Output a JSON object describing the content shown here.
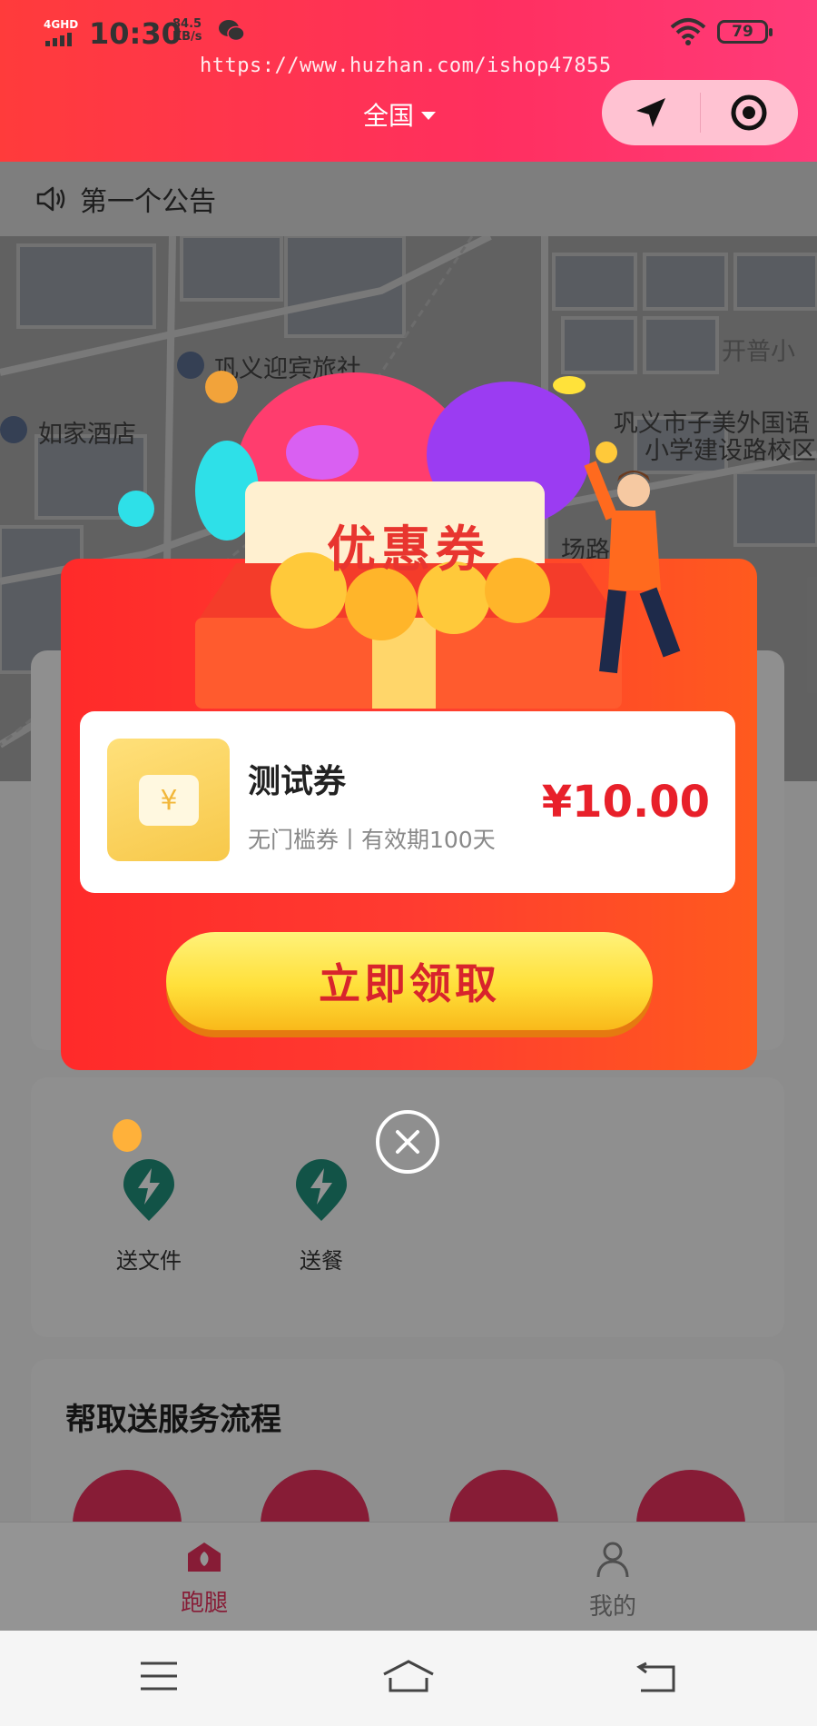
{
  "status_bar": {
    "network": "4GHD",
    "time": "10:30",
    "speed_value": "84.5",
    "speed_unit": "KB/s",
    "battery": "79"
  },
  "watermark": "https://www.huzhan.com/ishop47855",
  "header": {
    "region": "全国",
    "capsule": {
      "left_icon": "navigation-arrow-icon",
      "right_icon": "target-circle-icon"
    }
  },
  "notice": {
    "icon": "speaker-icon",
    "text": "第一个公告"
  },
  "map": {
    "labels": [
      "巩义迎宾旅社",
      "如家酒店",
      "开普小",
      "巩义市子美外国语",
      "小学建设路校区",
      "场路"
    ]
  },
  "services": [
    {
      "label": "送文件",
      "icon": "lightning-pin-icon"
    },
    {
      "label": "送餐",
      "icon": "lightning-pin-icon"
    }
  ],
  "flow": {
    "title": "帮取送服务流程"
  },
  "tabs": [
    {
      "label": "跑腿",
      "icon": "leaf-house-icon",
      "active": true
    },
    {
      "label": "我的",
      "icon": "user-icon",
      "active": false
    }
  ],
  "popup": {
    "banner_title": "优惠券",
    "coupon": {
      "name": "测试券",
      "desc": "无门槛券丨有效期100天",
      "amount": "¥10.00",
      "icon": "ticket-yen-icon"
    },
    "claim_button": "立即领取",
    "close_icon": "close-icon"
  },
  "colors": {
    "brand": "#ff2f5f",
    "coupon_red": "#e8202a",
    "button_yellow": "#ffe03a",
    "service_green": "#1f8f7a"
  }
}
